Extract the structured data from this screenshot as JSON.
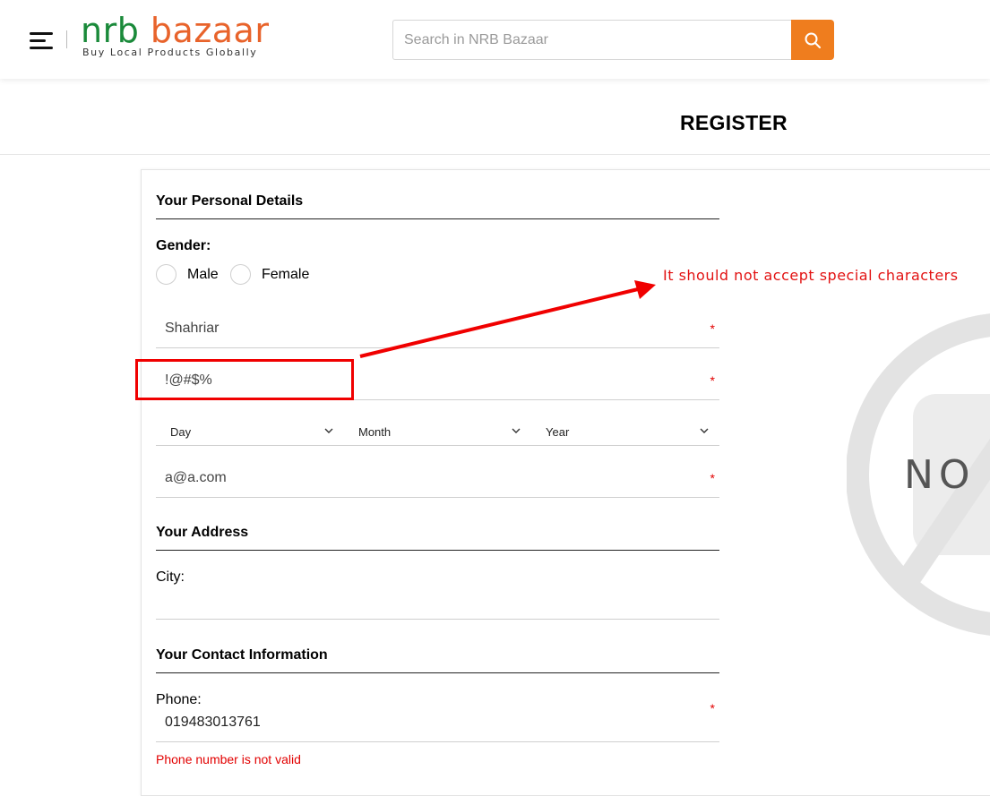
{
  "header": {
    "logo": {
      "part1": "nrb",
      "part2": "bazaar",
      "tagline": "Buy Local Products Globally"
    },
    "search": {
      "placeholder": "Search in NRB Bazaar"
    }
  },
  "page": {
    "title": "REGISTER"
  },
  "form": {
    "personal_section": "Your Personal Details",
    "gender_label": "Gender:",
    "gender_options": [
      "Male",
      "Female"
    ],
    "first_name_value": "Shahriar",
    "last_name_value": "!@#$%",
    "required_mark": "*",
    "dob": {
      "day": "Day",
      "month": "Month",
      "year": "Year"
    },
    "email_value": "a@a.com",
    "address_section": "Your Address",
    "city_label": "City:",
    "contact_section": "Your Contact Information",
    "phone_label": "Phone:",
    "phone_value": "019483013761",
    "phone_error": "Phone number is not valid"
  },
  "annotation": {
    "text": "It should not accept special characters"
  },
  "placeholder_image": {
    "text": "NO"
  },
  "colors": {
    "brand_green": "#1a8a3a",
    "brand_orange": "#e8632b",
    "search_button": "#ef7d1e",
    "error": "#e20000",
    "annotation": "#f00000"
  }
}
